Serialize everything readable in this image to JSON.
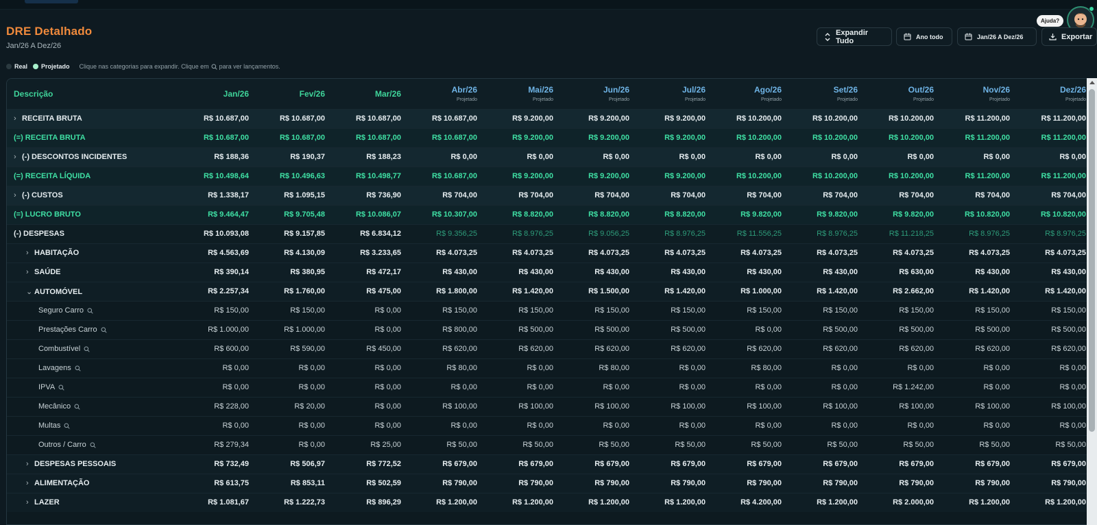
{
  "header": {
    "title": "DRE Detalhado",
    "subtitle": "Jan/26 A Dez/26",
    "help_label": "Ajuda?"
  },
  "toolbar": {
    "expand_label": "Expandir Tudo",
    "year_label": "Ano todo",
    "range_label": "Jan/26 A Dez/26",
    "export_label": "Exportar"
  },
  "legend": {
    "real_label": "Real",
    "projected_label": "Projetado",
    "hint_before": "Clique nas categorias para expandir. Clique em",
    "hint_after": "para ver lançamentos.",
    "real_color": "#2b3a40",
    "projected_color": "#a8f0cc"
  },
  "colors": {
    "accent_title": "#f08a3c",
    "green": "#3fe0a4",
    "projected_header": "#6fb4e6",
    "projected_value": "#2e9c7a"
  },
  "table": {
    "desc_header": "Descrição",
    "projected_sub": "Projetado",
    "months": [
      "Jan/26",
      "Fev/26",
      "Mar/26",
      "Abr/26",
      "Mai/26",
      "Jun/26",
      "Jul/26",
      "Ago/26",
      "Set/26",
      "Out/26",
      "Nov/26",
      "Dez/26"
    ],
    "rows": [
      {
        "label": "RECEITA BRUTA",
        "chev": "›",
        "type": "cat",
        "v": [
          "R$ 10.687,00",
          "R$ 10.687,00",
          "R$ 10.687,00",
          "R$ 10.687,00",
          "R$ 9.200,00",
          "R$ 9.200,00",
          "R$ 9.200,00",
          "R$ 10.200,00",
          "R$ 10.200,00",
          "R$ 10.200,00",
          "R$ 11.200,00",
          "R$ 11.200,00"
        ]
      },
      {
        "label": "(=) RECEITA BRUTA",
        "chev": "",
        "type": "tot",
        "v": [
          "R$ 10.687,00",
          "R$ 10.687,00",
          "R$ 10.687,00",
          "R$ 10.687,00",
          "R$ 9.200,00",
          "R$ 9.200,00",
          "R$ 9.200,00",
          "R$ 10.200,00",
          "R$ 10.200,00",
          "R$ 10.200,00",
          "R$ 11.200,00",
          "R$ 11.200,00"
        ]
      },
      {
        "label": "(-) DESCONTOS INCIDENTES",
        "chev": "›",
        "type": "cat",
        "v": [
          "R$ 188,36",
          "R$ 190,37",
          "R$ 188,23",
          "R$ 0,00",
          "R$ 0,00",
          "R$ 0,00",
          "R$ 0,00",
          "R$ 0,00",
          "R$ 0,00",
          "R$ 0,00",
          "R$ 0,00",
          "R$ 0,00"
        ]
      },
      {
        "label": "(=) RECEITA LÍQUIDA",
        "chev": "",
        "type": "tot",
        "v": [
          "R$ 10.498,64",
          "R$ 10.496,63",
          "R$ 10.498,77",
          "R$ 10.687,00",
          "R$ 9.200,00",
          "R$ 9.200,00",
          "R$ 9.200,00",
          "R$ 10.200,00",
          "R$ 10.200,00",
          "R$ 10.200,00",
          "R$ 11.200,00",
          "R$ 11.200,00"
        ]
      },
      {
        "label": "(-) CUSTOS",
        "chev": "›",
        "type": "cat",
        "v": [
          "R$ 1.338,17",
          "R$ 1.095,15",
          "R$ 736,90",
          "R$ 704,00",
          "R$ 704,00",
          "R$ 704,00",
          "R$ 704,00",
          "R$ 704,00",
          "R$ 704,00",
          "R$ 704,00",
          "R$ 704,00",
          "R$ 704,00"
        ]
      },
      {
        "label": "(=) LUCRO BRUTO",
        "chev": "",
        "type": "tot",
        "v": [
          "R$ 9.464,47",
          "R$ 9.705,48",
          "R$ 10.086,07",
          "R$ 10.307,00",
          "R$ 8.820,00",
          "R$ 8.820,00",
          "R$ 8.820,00",
          "R$ 9.820,00",
          "R$ 9.820,00",
          "R$ 9.820,00",
          "R$ 10.820,00",
          "R$ 10.820,00"
        ]
      },
      {
        "label": "(-) DESPESAS",
        "chev": "",
        "type": "desp",
        "v": [
          "R$ 10.093,08",
          "R$ 9.157,85",
          "R$ 6.834,12",
          "R$ 9.356,25",
          "R$ 8.976,25",
          "R$ 9.056,25",
          "R$ 8.976,25",
          "R$ 11.556,25",
          "R$ 8.976,25",
          "R$ 11.218,25",
          "R$ 8.976,25",
          "R$ 8.976,25"
        ]
      },
      {
        "label": "HABITAÇÃO",
        "chev": "›",
        "type": "sub",
        "v": [
          "R$ 4.563,69",
          "R$ 4.130,09",
          "R$ 3.233,65",
          "R$ 4.073,25",
          "R$ 4.073,25",
          "R$ 4.073,25",
          "R$ 4.073,25",
          "R$ 4.073,25",
          "R$ 4.073,25",
          "R$ 4.073,25",
          "R$ 4.073,25",
          "R$ 4.073,25"
        ]
      },
      {
        "label": "SAÚDE",
        "chev": "›",
        "type": "sub",
        "v": [
          "R$ 390,14",
          "R$ 380,95",
          "R$ 472,17",
          "R$ 430,00",
          "R$ 430,00",
          "R$ 430,00",
          "R$ 430,00",
          "R$ 430,00",
          "R$ 430,00",
          "R$ 630,00",
          "R$ 430,00",
          "R$ 430,00"
        ]
      },
      {
        "label": "AUTOMÓVEL",
        "chev": "⌄",
        "type": "sub",
        "v": [
          "R$ 2.257,34",
          "R$ 1.760,00",
          "R$ 475,00",
          "R$ 1.800,00",
          "R$ 1.420,00",
          "R$ 1.500,00",
          "R$ 1.420,00",
          "R$ 1.000,00",
          "R$ 1.420,00",
          "R$ 2.662,00",
          "R$ 1.420,00",
          "R$ 1.420,00"
        ]
      },
      {
        "label": "Seguro Carro",
        "chev": "",
        "type": "item",
        "v": [
          "R$ 150,00",
          "R$ 150,00",
          "R$ 0,00",
          "R$ 150,00",
          "R$ 150,00",
          "R$ 150,00",
          "R$ 150,00",
          "R$ 150,00",
          "R$ 150,00",
          "R$ 150,00",
          "R$ 150,00",
          "R$ 150,00"
        ]
      },
      {
        "label": "Prestações Carro",
        "chev": "",
        "type": "item",
        "v": [
          "R$ 1.000,00",
          "R$ 1.000,00",
          "R$ 0,00",
          "R$ 800,00",
          "R$ 500,00",
          "R$ 500,00",
          "R$ 500,00",
          "R$ 0,00",
          "R$ 500,00",
          "R$ 500,00",
          "R$ 500,00",
          "R$ 500,00"
        ]
      },
      {
        "label": "Combustível",
        "chev": "",
        "type": "item",
        "v": [
          "R$ 600,00",
          "R$ 590,00",
          "R$ 450,00",
          "R$ 620,00",
          "R$ 620,00",
          "R$ 620,00",
          "R$ 620,00",
          "R$ 620,00",
          "R$ 620,00",
          "R$ 620,00",
          "R$ 620,00",
          "R$ 620,00"
        ]
      },
      {
        "label": "Lavagens",
        "chev": "",
        "type": "item",
        "v": [
          "R$ 0,00",
          "R$ 0,00",
          "R$ 0,00",
          "R$ 80,00",
          "R$ 0,00",
          "R$ 80,00",
          "R$ 0,00",
          "R$ 80,00",
          "R$ 0,00",
          "R$ 0,00",
          "R$ 0,00",
          "R$ 0,00"
        ]
      },
      {
        "label": "IPVA",
        "chev": "",
        "type": "item",
        "v": [
          "R$ 0,00",
          "R$ 0,00",
          "R$ 0,00",
          "R$ 0,00",
          "R$ 0,00",
          "R$ 0,00",
          "R$ 0,00",
          "R$ 0,00",
          "R$ 0,00",
          "R$ 1.242,00",
          "R$ 0,00",
          "R$ 0,00"
        ]
      },
      {
        "label": "Mecânico",
        "chev": "",
        "type": "item",
        "v": [
          "R$ 228,00",
          "R$ 20,00",
          "R$ 0,00",
          "R$ 100,00",
          "R$ 100,00",
          "R$ 100,00",
          "R$ 100,00",
          "R$ 100,00",
          "R$ 100,00",
          "R$ 100,00",
          "R$ 100,00",
          "R$ 100,00"
        ]
      },
      {
        "label": "Multas",
        "chev": "",
        "type": "item",
        "v": [
          "R$ 0,00",
          "R$ 0,00",
          "R$ 0,00",
          "R$ 0,00",
          "R$ 0,00",
          "R$ 0,00",
          "R$ 0,00",
          "R$ 0,00",
          "R$ 0,00",
          "R$ 0,00",
          "R$ 0,00",
          "R$ 0,00"
        ]
      },
      {
        "label": "Outros / Carro",
        "chev": "",
        "type": "item",
        "v": [
          "R$ 279,34",
          "R$ 0,00",
          "R$ 25,00",
          "R$ 50,00",
          "R$ 50,00",
          "R$ 50,00",
          "R$ 50,00",
          "R$ 50,00",
          "R$ 50,00",
          "R$ 50,00",
          "R$ 50,00",
          "R$ 50,00"
        ]
      },
      {
        "label": "DESPESAS PESSOAIS",
        "chev": "›",
        "type": "sub",
        "v": [
          "R$ 732,49",
          "R$ 506,97",
          "R$ 772,52",
          "R$ 679,00",
          "R$ 679,00",
          "R$ 679,00",
          "R$ 679,00",
          "R$ 679,00",
          "R$ 679,00",
          "R$ 679,00",
          "R$ 679,00",
          "R$ 679,00"
        ]
      },
      {
        "label": "ALIMENTAÇÃO",
        "chev": "›",
        "type": "sub",
        "v": [
          "R$ 613,75",
          "R$ 853,11",
          "R$ 502,59",
          "R$ 790,00",
          "R$ 790,00",
          "R$ 790,00",
          "R$ 790,00",
          "R$ 790,00",
          "R$ 790,00",
          "R$ 790,00",
          "R$ 790,00",
          "R$ 790,00"
        ]
      },
      {
        "label": "LAZER",
        "chev": "›",
        "type": "sub",
        "v": [
          "R$ 1.081,67",
          "R$ 1.222,73",
          "R$ 896,29",
          "R$ 1.200,00",
          "R$ 1.200,00",
          "R$ 1.200,00",
          "R$ 1.200,00",
          "R$ 4.200,00",
          "R$ 1.200,00",
          "R$ 2.000,00",
          "R$ 1.200,00",
          "R$ 1.200,00"
        ]
      }
    ]
  }
}
